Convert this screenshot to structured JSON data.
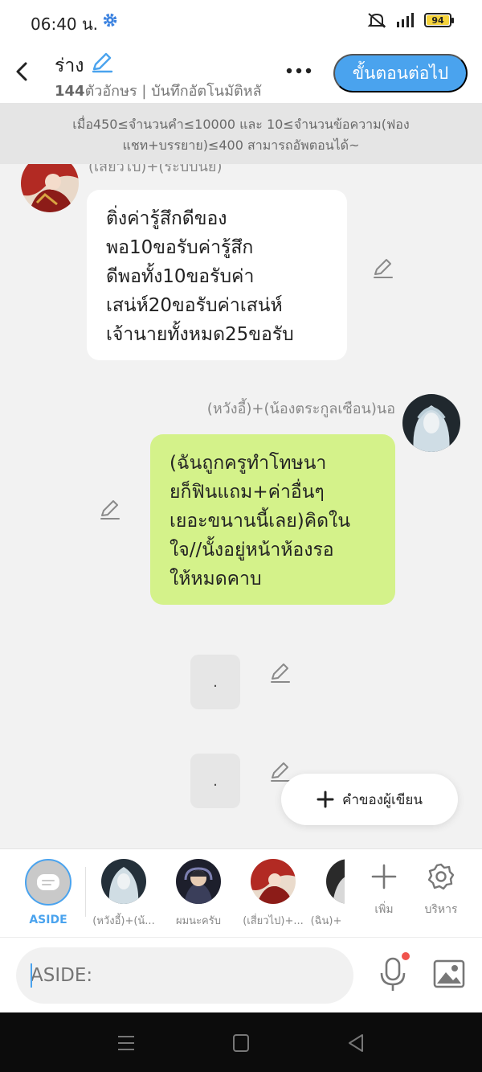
{
  "status_bar": {
    "time": "06:40 น.",
    "battery": "94",
    "battery_level": 0.94
  },
  "header": {
    "title": "ร่าง",
    "char_count": "144",
    "subtitle_rest": "ตัวอักษร | บันทึกอัตโนมัติหลั",
    "next_button": "ขั้นตอนต่อไป"
  },
  "notice": {
    "line1": "เมื่อ450≤จำนวนคำ≤10000 และ 10≤จำนวนข้อความ(ฟอง",
    "line2": "แชท+บรรยาย)≤400 สามารถอัพตอนได้~"
  },
  "messages": [
    {
      "sender": "(เสี่ยวไป)+(ระบบนิย)",
      "lines": [
        "ติ่งค่ารู้สึกดีของ",
        "พอ10ขอรับค่ารู้สึก",
        "ดีพอทั้ง10ขอรับค่า",
        "เสน่ห์20ขอรับค่าเสน่ห์",
        "เจ้านายทั้งหมด25ขอรับ"
      ]
    },
    {
      "sender": "(หวังอี้)+(น้องตระกูลเซือน)นอ",
      "lines": [
        "(ฉันถูกครูทำโทษนา",
        "ยก็ฟินแถม+ค่าอื่นๆ",
        "เยอะขนานนี้เลย)คิดใน",
        "ใจ//นั้งอยู่หน้าห้องรอ",
        "ให้หมดคาบ"
      ]
    },
    {
      "text": "."
    },
    {
      "text": "."
    }
  ],
  "author_words_button": "คำของผู้เขียน",
  "characters": [
    {
      "label": "ASIDE"
    },
    {
      "label": "(หวังอี้)+(น้..."
    },
    {
      "label": "ผมนะครับ"
    },
    {
      "label": "(เสี่ยวไป)+..."
    },
    {
      "label": "(ฉิน)+"
    }
  ],
  "tools": {
    "add": "เพิ่ม",
    "manage": "บริหาร"
  },
  "input": {
    "placeholder": "ASIDE:"
  },
  "colors": {
    "accent": "#4aa3ee",
    "green_bubble": "#d4f28a",
    "notification_dot": "#f0534d"
  }
}
